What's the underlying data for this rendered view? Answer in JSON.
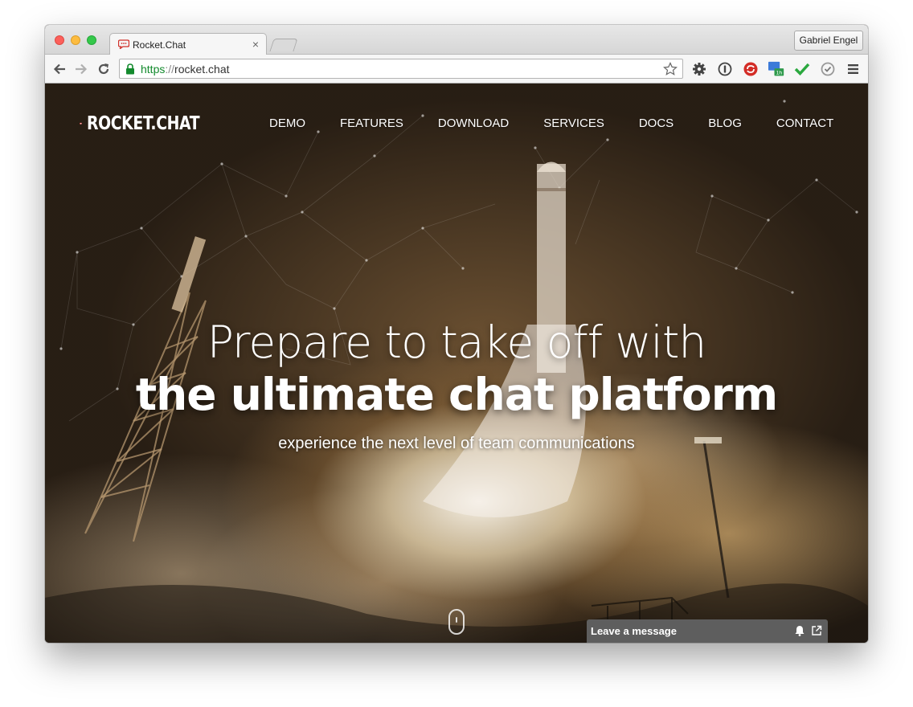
{
  "browser": {
    "tab_title": "Rocket.Chat",
    "profile_name": "Gabriel Engel",
    "url_scheme": "https",
    "url_separator": "://",
    "url_host": "rocket.chat",
    "extension_badge": "1h",
    "icons": [
      "back-icon",
      "forward-icon",
      "reload-icon",
      "lock-icon",
      "star-icon",
      "gear-icon",
      "info-icon",
      "lastpass-icon",
      "calendar-extension-icon",
      "checkmark-icon",
      "clock-check-icon",
      "menu-icon"
    ]
  },
  "site": {
    "logo_text": "ROCKET.CHAT",
    "nav": [
      "DEMO",
      "FEATURES",
      "DOWNLOAD",
      "SERVICES",
      "DOCS",
      "BLOG",
      "CONTACT"
    ],
    "hero": {
      "line1": "Prepare to take off with",
      "line2": "the ultimate chat platform",
      "subtitle": "experience the next level of team communications"
    },
    "livechat": {
      "label": "Leave a message"
    },
    "colors": {
      "brand_red": "#db2323",
      "livechat_bar": "#5e5e5e",
      "url_green": "#138a2d"
    }
  }
}
